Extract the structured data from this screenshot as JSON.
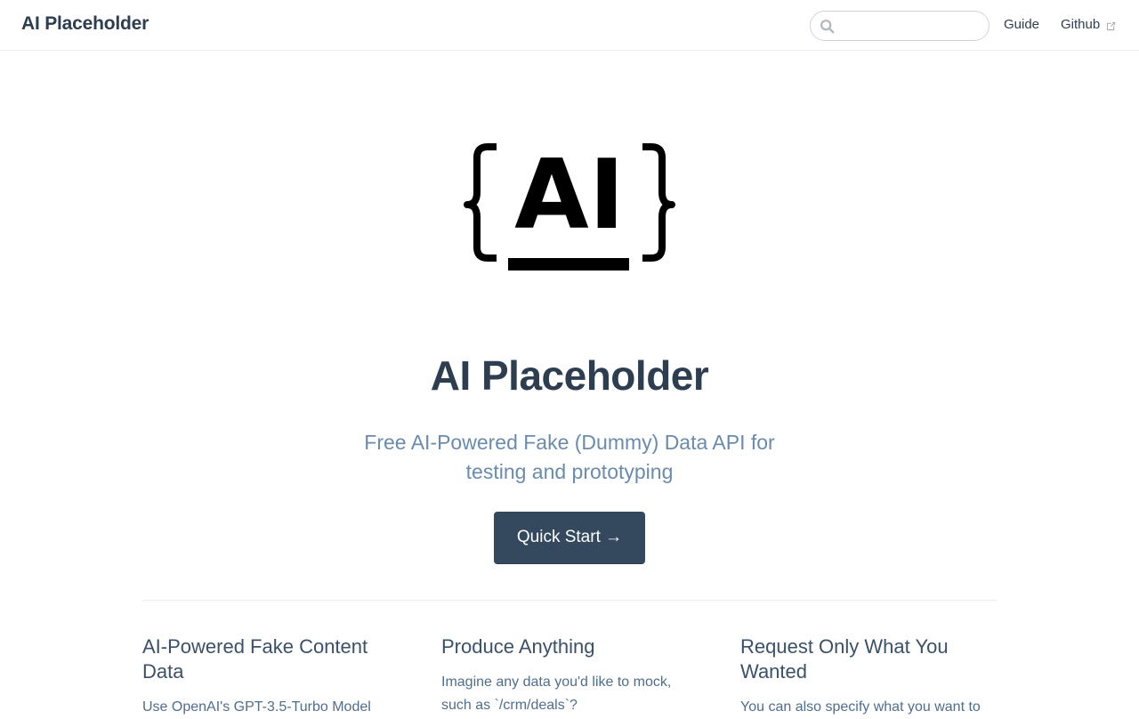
{
  "navbar": {
    "site_name": "AI Placeholder",
    "search": {
      "value": "",
      "placeholder": ""
    },
    "links": [
      {
        "label": "Guide"
      },
      {
        "label": "Github"
      }
    ]
  },
  "hero": {
    "logo_text": "AI",
    "title": "AI Placeholder",
    "description": "Free AI-Powered Fake (Dummy) Data API for testing and prototyping",
    "cta_label": "Quick Start →"
  },
  "features": [
    {
      "title": "AI-Powered Fake Content Data",
      "text": "Use OpenAI's GPT-3.5-Turbo Model"
    },
    {
      "title": "Produce Anything",
      "text": "Imagine any data you'd like to mock, such as `/crm/deals`?"
    },
    {
      "title": "Request Only What You Wanted",
      "text": "You can also specify what you want to"
    }
  ],
  "colors": {
    "accent": "#34495e",
    "text": "#2c3e50",
    "description": "#6a8bad"
  },
  "icons": {
    "search": "search-icon",
    "external": "external-link-icon"
  }
}
